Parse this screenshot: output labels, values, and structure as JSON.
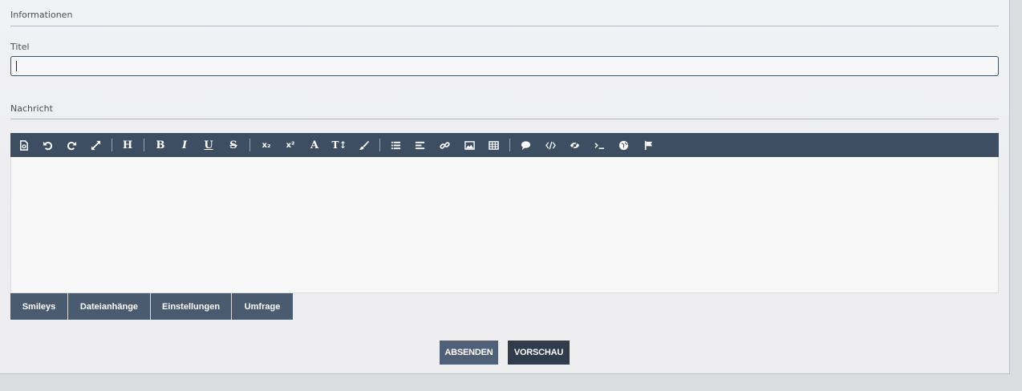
{
  "section_informationen": "Informationen",
  "field_titel": {
    "label": "Titel",
    "value": ""
  },
  "section_nachricht": "Nachricht",
  "toolbar": {
    "heading": "H",
    "bold": "B",
    "italic": "I",
    "underline": "U",
    "strike": "S",
    "subscript": "x₂",
    "superscript": "x²",
    "font": "A",
    "font_size": "T↕",
    "icons": [
      "source-icon",
      "undo-icon",
      "redo-icon",
      "fullscreen-icon",
      "brush-icon",
      "list-icon",
      "align-icon",
      "link-icon",
      "image-icon",
      "table-icon",
      "quote-icon",
      "code-icon",
      "spoiler-icon",
      "terminal-icon",
      "globe-icon",
      "flag-icon"
    ]
  },
  "tabs": [
    "Smileys",
    "Dateianhänge",
    "Einstellungen",
    "Umfrage"
  ],
  "buttons": {
    "submit": "ABSENDEN",
    "preview": "VORSCHAU"
  },
  "colors": {
    "toolbar": "#3d4e62",
    "tab": "#4a5b70",
    "submit": "#4f6078",
    "preview": "#2f3c4b"
  }
}
